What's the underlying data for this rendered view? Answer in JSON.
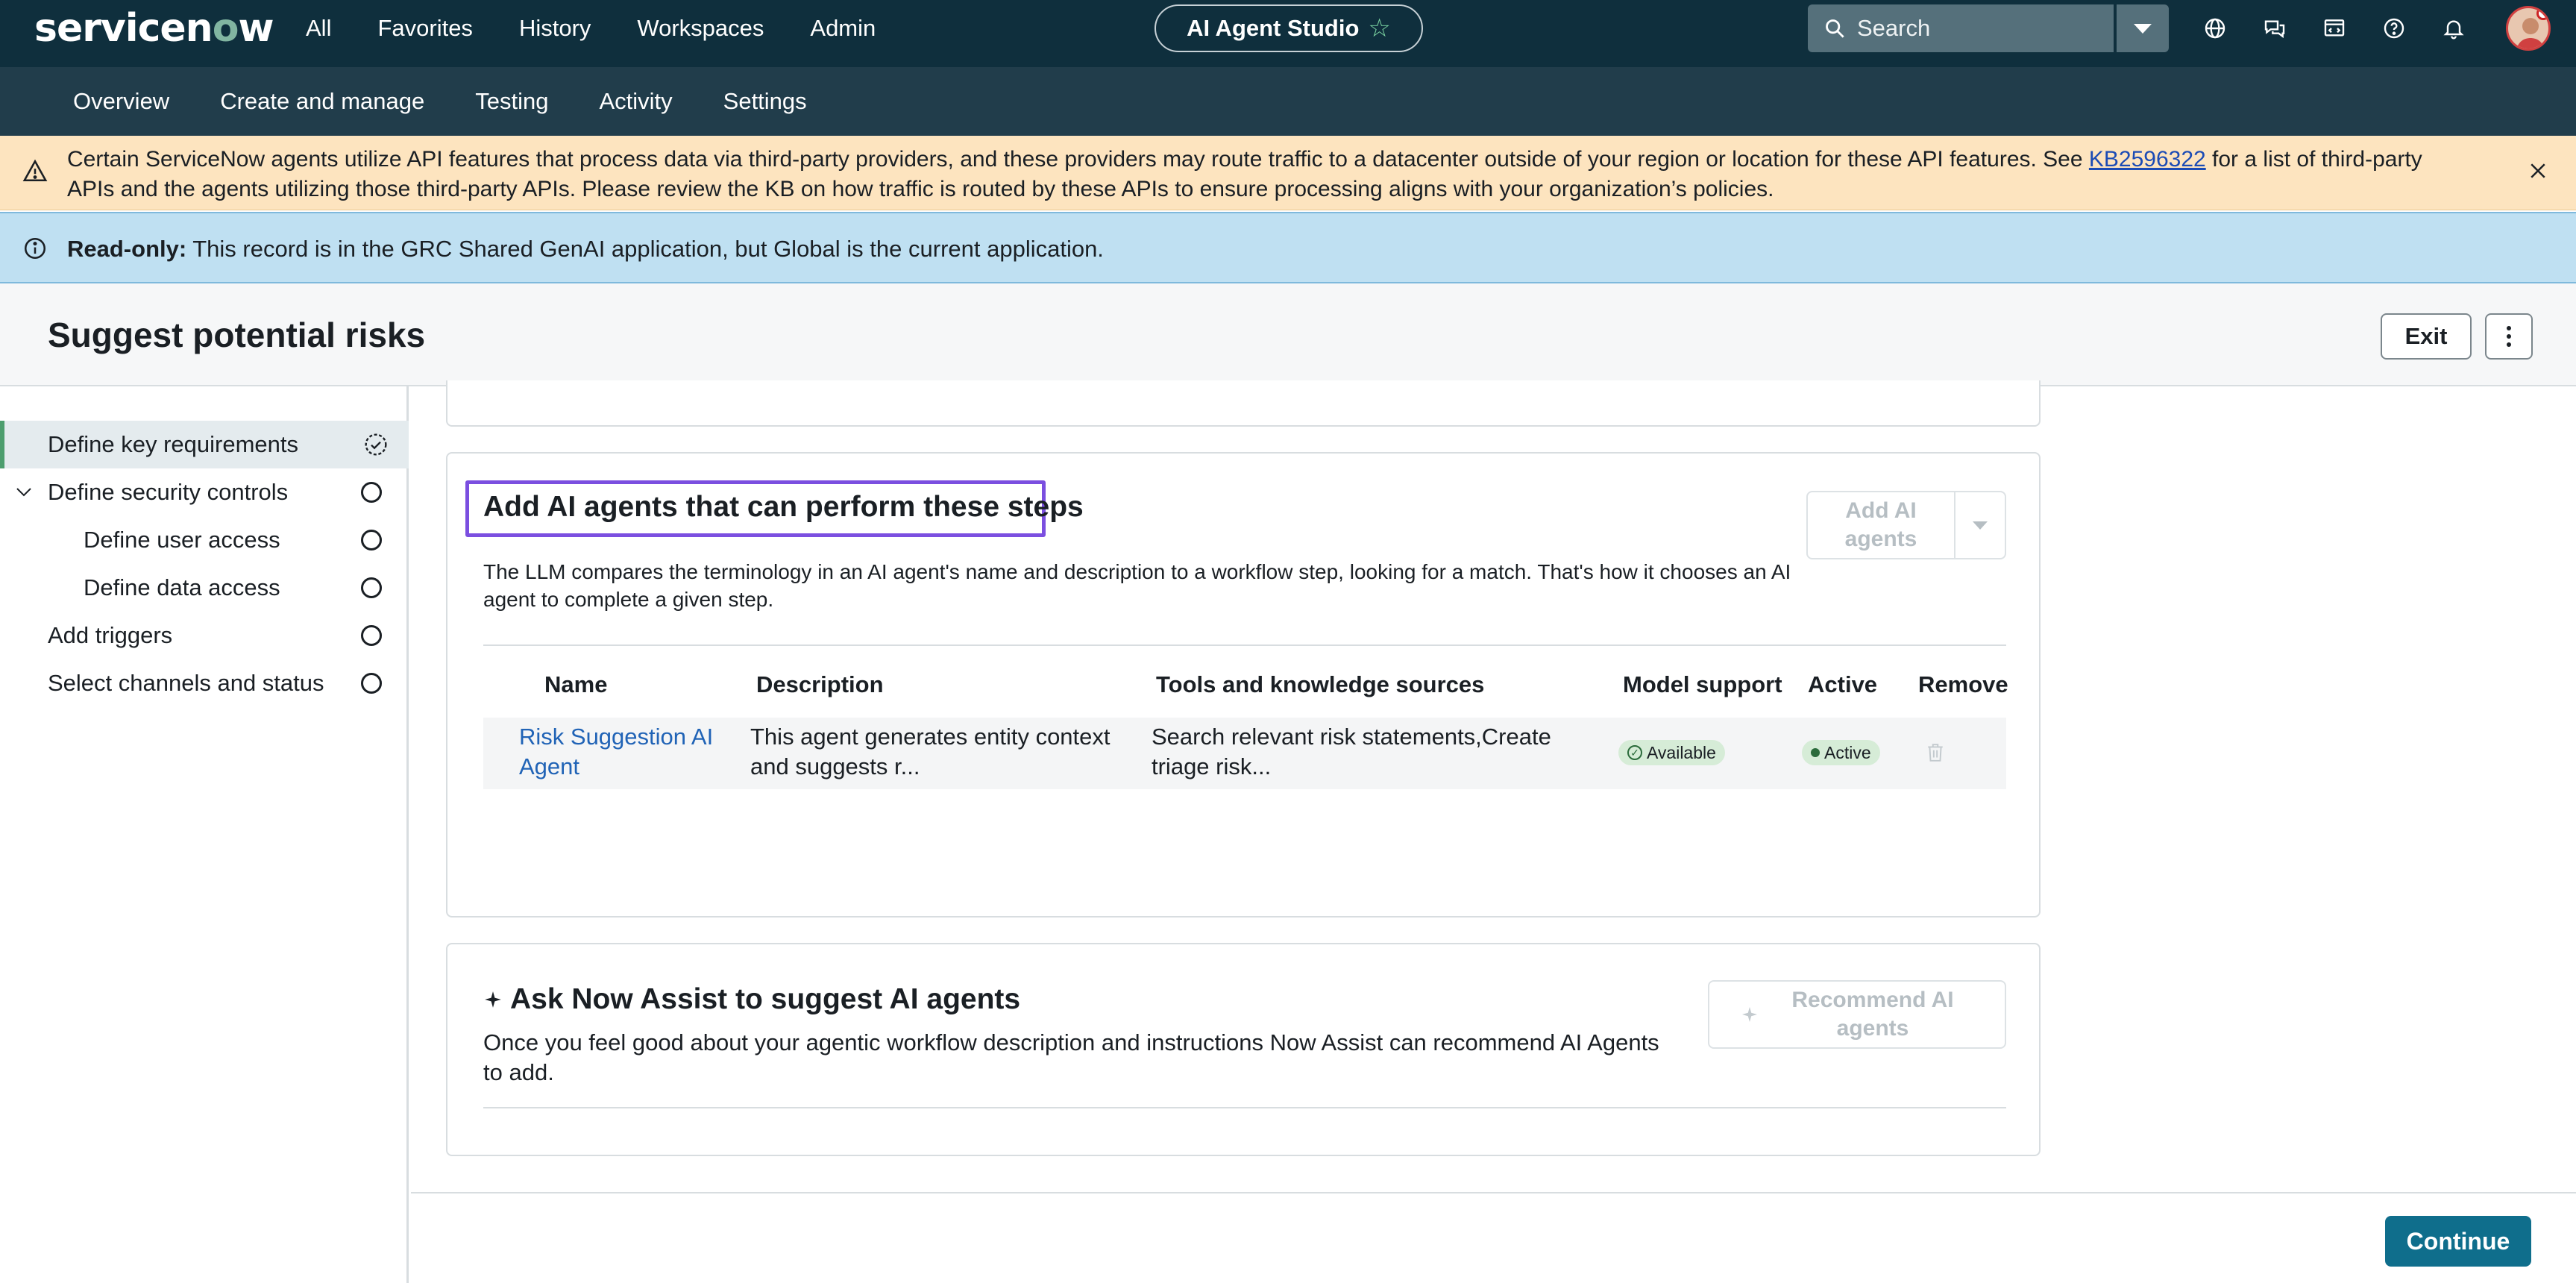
{
  "topbar": {
    "logo": "servicenow",
    "nav": [
      "All",
      "Favorites",
      "History",
      "Workspaces",
      "Admin"
    ],
    "studio": "AI Agent Studio",
    "search_placeholder": "Search",
    "icons": [
      "globe-icon",
      "chat-icon",
      "scripts-icon",
      "help-icon",
      "bell-icon"
    ]
  },
  "subnav": [
    "Overview",
    "Create and manage",
    "Testing",
    "Activity",
    "Settings"
  ],
  "warning": {
    "text_before": "Certain ServiceNow agents utilize API features that process data via third-party providers, and these providers may route traffic to a datacenter outside of your region or location for these API features. See ",
    "link": "KB2596322",
    "text_after": " for a list of third-party APIs and the agents utilizing those third-party APIs. Please review the KB on how traffic is routed by these APIs to ensure processing aligns with your organization’s policies."
  },
  "info": {
    "label": "Read-only:",
    "text": " This record is in the GRC Shared GenAI application, but Global is the current application."
  },
  "page": {
    "title": "Suggest potential risks",
    "exit": "Exit",
    "continue": "Continue"
  },
  "steps": [
    {
      "label": "Define key requirements",
      "state": "done"
    },
    {
      "label": "Define security controls",
      "state": "todo"
    },
    {
      "label": "Define user access",
      "state": "todo"
    },
    {
      "label": "Define data access",
      "state": "todo"
    },
    {
      "label": "Add triggers",
      "state": "todo"
    },
    {
      "label": "Select channels and status",
      "state": "todo"
    }
  ],
  "agents_card": {
    "heading": "Add AI agents that can perform these steps",
    "description": "The LLM compares the terminology in an AI agent's name and description to a workflow step, looking for a match. That's how it chooses an AI agent to complete a given step.",
    "add_button": "Add AI agents",
    "columns": [
      "Name",
      "Description",
      "Tools and knowledge sources",
      "Model support",
      "Active",
      "Remove"
    ],
    "rows": [
      {
        "name": "Risk Suggestion AI Agent",
        "description": "This agent generates entity context and suggests r...",
        "tools": "Search relevant risk statements,Create triage risk...",
        "model_support": "Available",
        "active": "Active"
      }
    ]
  },
  "assist_card": {
    "heading": "Ask Now Assist to suggest AI agents",
    "description": "Once you feel good about your agentic workflow description and instructions Now Assist can recommend AI Agents to add.",
    "button": "Recommend AI agents"
  },
  "colors": {
    "topbar": "#0f2f3d",
    "subnav": "#213d4b",
    "warning_bg": "#fde4bf",
    "info_bg": "#bfe0f2",
    "highlight": "#7b4fe0",
    "primary": "#0f6e8c",
    "link": "#2063b6"
  }
}
